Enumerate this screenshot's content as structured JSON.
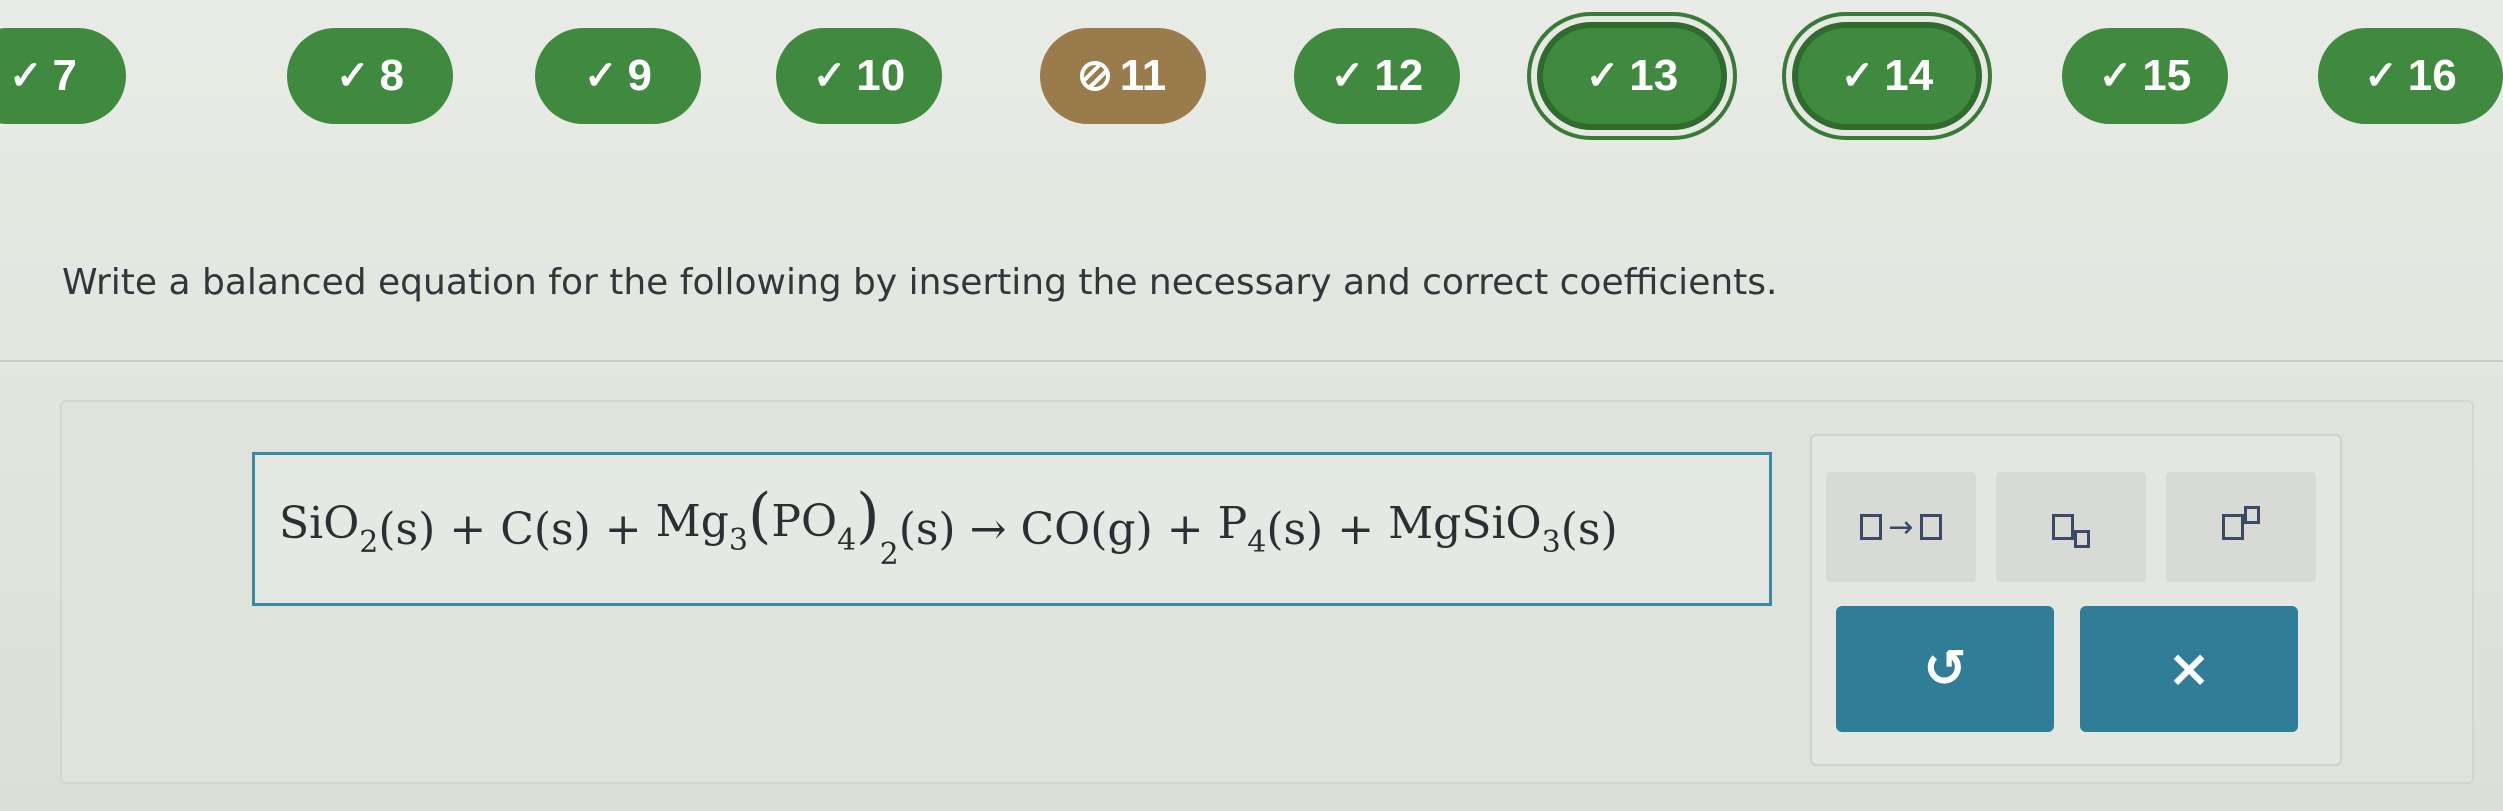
{
  "questions": [
    {
      "number": "7",
      "status": "correct",
      "icon": "check-icon",
      "mark": "✓"
    },
    {
      "number": "8",
      "status": "correct",
      "icon": "check-icon",
      "mark": "✓"
    },
    {
      "number": "9",
      "status": "correct",
      "icon": "check-icon",
      "mark": "✓"
    },
    {
      "number": "10",
      "status": "correct",
      "icon": "check-icon",
      "mark": "✓"
    },
    {
      "number": "11",
      "status": "partial",
      "icon": "partial-credit-icon",
      "mark": ""
    },
    {
      "number": "12",
      "status": "correct",
      "icon": "check-icon",
      "mark": "✓"
    },
    {
      "number": "13",
      "status": "current",
      "icon": "check-icon",
      "mark": "✓"
    },
    {
      "number": "14",
      "status": "current",
      "icon": "check-icon",
      "mark": "✓"
    },
    {
      "number": "15",
      "status": "correct",
      "icon": "check-icon",
      "mark": "✓"
    },
    {
      "number": "16",
      "status": "correct",
      "icon": "check-icon",
      "mark": "✓"
    }
  ],
  "prompt": "Write a balanced equation for the following by inserting the necessary and correct coefficients.",
  "equation": {
    "sio2_main": "SiO",
    "sio2_sub": "2",
    "sio2_state": "(s)",
    "plus1": "+",
    "c": "C",
    "c_state": "(s)",
    "plus2": "+",
    "mg_main": "Mg",
    "mg_sub": "3",
    "po4_open": "(",
    "po4_main": "PO",
    "po4_sub": "4",
    "po4_close": ")",
    "po4_outer_sub": "2",
    "mgpo4_state": "(s)",
    "arrow": "→",
    "co": "CO",
    "co_state": "(g)",
    "plus3": "+",
    "p_main": "P",
    "p_sub": "4",
    "p_state": "(s)",
    "plus4": "+",
    "mgsio3_main": "MgSiO",
    "mgsio3_sub": "3",
    "mgsio3_state": "(s)"
  },
  "tools": {
    "reaction_arrow_symbol": "→",
    "subscript_tool": "subscript",
    "superscript_tool": "superscript"
  },
  "actions": {
    "undo_symbol": "↺",
    "clear_symbol": "×"
  },
  "colors": {
    "correct_green": "#3f8a3e",
    "partial_brown": "#9a7b4b",
    "action_teal": "#2f7d96",
    "input_border": "#3c8aa3"
  }
}
